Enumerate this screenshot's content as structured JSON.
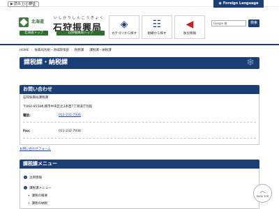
{
  "topbar": {
    "read_aloud": "読み上げる",
    "stop": "停止",
    "foreign_language": "Foreign Language"
  },
  "header": {
    "pref_name": "北海道",
    "office_ruby": "いしかりしんこうきょく",
    "office_name": "石狩振興局",
    "pref_top_button": "北海道トップ",
    "office_top_button": "石狩振興局トップ",
    "nav": {
      "category": "カテゴリから探す",
      "organization": "組織から探す",
      "disaster": "防災情報"
    },
    "search": {
      "placeholder": "Google 検",
      "button": "検索"
    }
  },
  "breadcrumb": [
    "HOME",
    "振興局別組・地域政策部",
    "税務課",
    "課税課・納税課"
  ],
  "page": {
    "title": "課税課・納税課"
  },
  "contact": {
    "heading": "お問い合わせ",
    "org": "石狩振興局課税課",
    "address": "〒060-8558札幌市中央区北3条西7丁目道庁別館",
    "tel_label": "電話:",
    "tel": "011-231-7936",
    "fax_label": "Fax:",
    "fax": "011-232-7938",
    "form_link": "お問い合わせフォーム"
  },
  "menu": {
    "heading": "課税課メニュー",
    "items": [
      {
        "label": "注目情報",
        "marker": "›"
      },
      {
        "label": "課税課メニュー",
        "marker": "›"
      },
      {
        "label": "課税の概要"
      },
      {
        "label": "課税の納税"
      }
    ]
  },
  "page_top": {
    "label": "PAGE TOP"
  },
  "colors": {
    "navy": "#1b3f74",
    "green": "#2f6f2f",
    "disaster_red": "#c81e1e",
    "link": "#1a3fbf"
  }
}
